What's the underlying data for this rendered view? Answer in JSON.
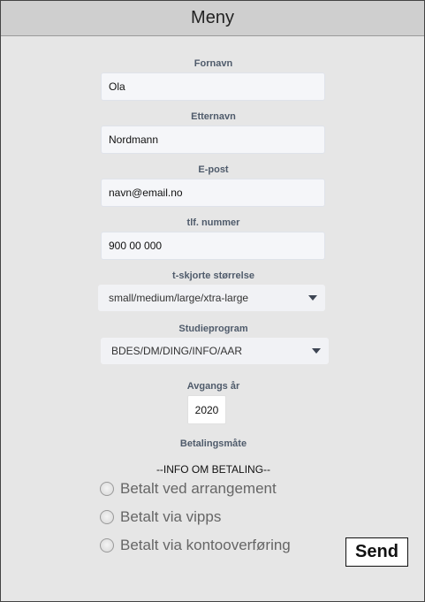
{
  "header": {
    "title": "Meny"
  },
  "form": {
    "first_name": {
      "label": "Fornavn",
      "value": "Ola"
    },
    "last_name": {
      "label": "Etternavn",
      "value": "Nordmann"
    },
    "email": {
      "label": "E-post",
      "value": "navn@email.no"
    },
    "phone": {
      "label": "tlf. nummer",
      "value": "900 00 000"
    },
    "tshirt": {
      "label": "t-skjorte størrelse",
      "value": "small/medium/large/xtra-large",
      "icon": "chevron-down-icon"
    },
    "program": {
      "label": "Studieprogram",
      "value": "BDES/DM/DING/INFO/AAR",
      "icon": "chevron-down-icon"
    },
    "graduation_year": {
      "label": "Avgangs år",
      "value": "2020"
    },
    "payment": {
      "label": "Betalingsmåte",
      "info": "--INFO OM BETALING--",
      "options": [
        {
          "label": "Betalt ved arrangement",
          "selected": false
        },
        {
          "label": "Betalt via vipps",
          "selected": false
        },
        {
          "label": "Betalt via kontooverføring",
          "selected": false
        }
      ]
    },
    "send_label": "Send"
  }
}
